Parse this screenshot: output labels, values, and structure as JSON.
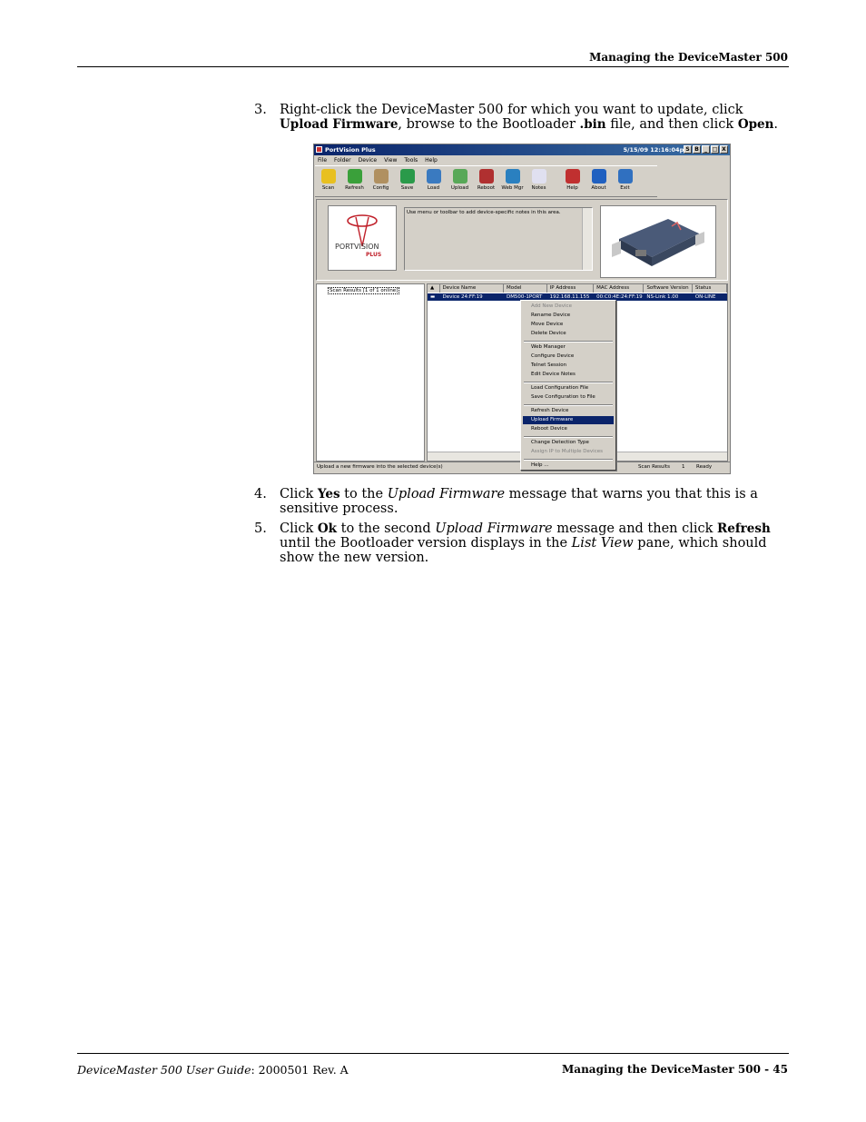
{
  "header": {
    "title": "Managing the DeviceMaster 500"
  },
  "steps": [
    {
      "num": "3.",
      "parts": [
        {
          "t": "Right-click the DeviceMaster 500 for which you want to update, click "
        },
        {
          "t": "Upload Firmware",
          "b": true
        },
        {
          "t": ", browse to the Bootloader "
        },
        {
          "t": ".bin",
          "b": true
        },
        {
          "t": " file, and then click "
        },
        {
          "t": "Open",
          "b": true
        },
        {
          "t": "."
        }
      ]
    },
    {
      "num": "4.",
      "parts": [
        {
          "t": "Click "
        },
        {
          "t": "Yes",
          "b": true
        },
        {
          "t": " to the "
        },
        {
          "t": "Upload Firmware",
          "i": true
        },
        {
          "t": " message that warns you that this is a sensitive process."
        }
      ]
    },
    {
      "num": "5.",
      "parts": [
        {
          "t": "Click "
        },
        {
          "t": "Ok",
          "b": true
        },
        {
          "t": " to the second "
        },
        {
          "t": "Upload Firmware",
          "i": true
        },
        {
          "t": " message and then click "
        },
        {
          "t": "Refresh",
          "b": true
        },
        {
          "t": " until the Bootloader version displays in the "
        },
        {
          "t": "List View",
          "i": true
        },
        {
          "t": " pane, which should show the new version."
        }
      ]
    }
  ],
  "screenshot": {
    "title": "PortVision Plus",
    "time": "5/15/09 12:16:04pm",
    "window_buttons": [
      "S",
      "B",
      "_",
      "□",
      "X"
    ],
    "menu": [
      "File",
      "Folder",
      "Device",
      "View",
      "Tools",
      "Help"
    ],
    "toolbar": [
      {
        "label": "Scan",
        "color": "#e8c020"
      },
      {
        "label": "Refresh",
        "color": "#3aa03a"
      },
      {
        "label": "Config",
        "color": "#b09060"
      },
      {
        "label": "Save",
        "color": "#2a9a4a"
      },
      {
        "label": "Load",
        "color": "#3a7ac0"
      },
      {
        "label": "Upload",
        "color": "#58a858"
      },
      {
        "label": "Reboot",
        "color": "#b03030"
      },
      {
        "label": "Web Mgr",
        "color": "#2a80c0"
      },
      {
        "label": "Notes",
        "color": "#e0e0f0"
      },
      {
        "label": "Help",
        "color": "#c03030"
      },
      {
        "label": "About",
        "color": "#2060c0"
      },
      {
        "label": "Exit",
        "color": "#3070c0"
      }
    ],
    "logo_text": "PORTVISION",
    "logo_sub": "PLUS",
    "notes_text": "Use menu or toolbar to add device-specific notes in this area.",
    "tree_node": "Scan Results [1 of 1 online]",
    "columns": [
      "Device Name",
      "Model",
      "IP Address",
      "MAC Address",
      "Software Version",
      "Status"
    ],
    "row": [
      "Device 24:FF:19",
      "DM500-1PORT",
      "192.168.11.155",
      "00:C0:4E:24:FF:19",
      "NS-Link 1.00",
      "ON-LINE"
    ],
    "status_left": "Upload a new firmware into the selected device(s)",
    "status_scan": "Scan Results",
    "status_count": "1",
    "status_ready": "Ready",
    "context_menu": [
      {
        "label": "Add New Device",
        "state": "disabled"
      },
      {
        "label": "Rename Device"
      },
      {
        "label": "Move Device"
      },
      {
        "label": "Delete Device"
      },
      {
        "sep": true
      },
      {
        "label": "Web Manager"
      },
      {
        "label": "Configure Device"
      },
      {
        "label": "Telnet Session"
      },
      {
        "label": "Edit Device Notes"
      },
      {
        "sep": true
      },
      {
        "label": "Load Configuration File"
      },
      {
        "label": "Save Configuration to File"
      },
      {
        "sep": true
      },
      {
        "label": "Refresh Device"
      },
      {
        "label": "Upload Firmware",
        "state": "selected"
      },
      {
        "label": "Reboot Device"
      },
      {
        "sep": true
      },
      {
        "label": "Change Detection Type"
      },
      {
        "label": "Assign IP to Multiple Devices",
        "state": "disabled"
      },
      {
        "sep": true
      },
      {
        "label": "Help ..."
      }
    ]
  },
  "footer": {
    "left_italic": "DeviceMaster 500 User Guide",
    "left_rest": ": 2000501 Rev. A",
    "right": "Managing the DeviceMaster 500 - 45"
  }
}
